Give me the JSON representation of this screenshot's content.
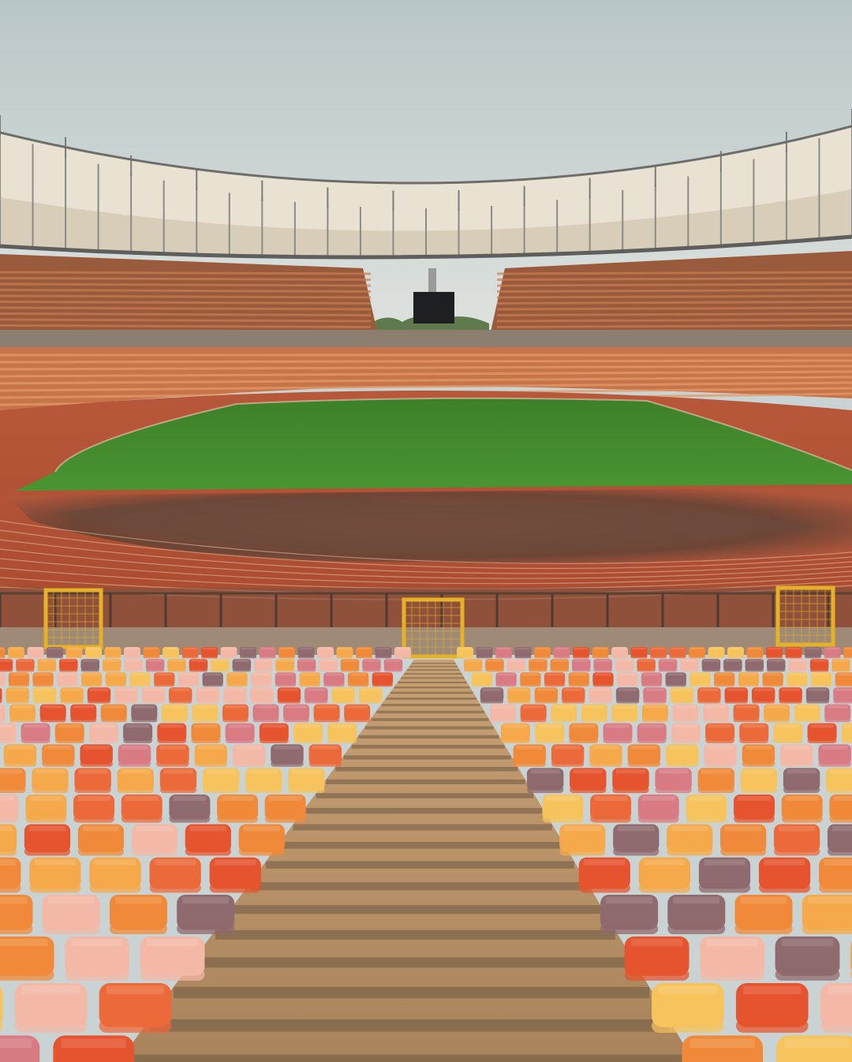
{
  "photo": {
    "subject": "stadium",
    "palette": {
      "sky": "#c9d3d3",
      "roof": "#e8e1d3",
      "roof_shadow": "#b8ac98",
      "truss": "#6c6c6c",
      "stand_far": "#b56844",
      "stand_seat": "#d98a57",
      "pitch": "#3f8a2c",
      "pitch_light": "#4f9a36",
      "track": "#c25a36",
      "track_lines": "#e8c4a8",
      "infield_dark": "#7a4a35",
      "fence": "#7b5c48",
      "gate": "#e5b126",
      "stairs": "#b89063",
      "stairs_shadow": "#5b4a3a"
    },
    "seat_colors": [
      "#f08a3a",
      "#f5a94a",
      "#e5542e",
      "#f3b8a6",
      "#8f6a6e",
      "#f6c35c",
      "#ec6a3a",
      "#d97b83"
    ]
  }
}
